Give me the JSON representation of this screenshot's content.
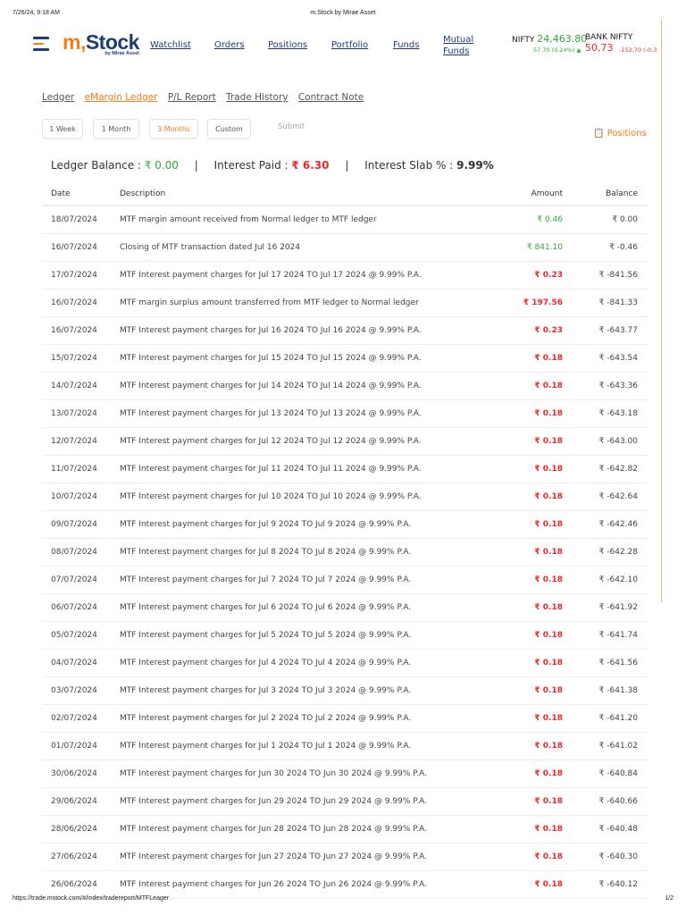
{
  "print_header": {
    "datetime": "7/26/24, 9:18 AM",
    "title": "m.Stock by Mirae Asset"
  },
  "logo": {
    "m": "m,",
    "stock": "Stock",
    "tagline": "by Mirae Asset"
  },
  "nav": [
    "Watchlist",
    "Orders",
    "Positions",
    "Portfolio",
    "Funds",
    "Mutual",
    "Funds"
  ],
  "indices": [
    {
      "name": "NIFTY",
      "value": "24,463.80",
      "change": "57.70 (0.24%)",
      "color": "#2eaa3c"
    },
    {
      "name": "BANK NIFTY",
      "value": "50,73",
      "change": "-152.70 (-0.3",
      "color": "#f0282d"
    }
  ],
  "subtabs": [
    "Ledger",
    "eMargin Ledger",
    "P/L Report",
    "Trade History",
    "Contract Note"
  ],
  "filters": [
    "1 Week",
    "1 Month",
    "3 Months",
    "Custom"
  ],
  "submit": "Submit",
  "positions_link": "Positions",
  "summary": {
    "ledger_label": "Ledger Balance : ",
    "ledger_value": "₹ 0.00",
    "interest_label": "Interest Paid : ",
    "interest_value": "₹ 6.30",
    "slab_label": "Interest Slab % : ",
    "slab_value": "9.99%",
    "sep": "|"
  },
  "table": {
    "headers": [
      "Date",
      "Description",
      "Amount",
      "Balance"
    ],
    "rows": [
      [
        "18/07/2024",
        "MTF margin amount received from Normal ledger to MTF ledger",
        "₹ 0.46",
        "₹ 0.00",
        "g"
      ],
      [
        "16/07/2024",
        "Closing of MTF transaction dated Jul 16 2024",
        "₹ 841.10",
        "₹ -0.46",
        "g"
      ],
      [
        "17/07/2024",
        "MTF Interest payment charges for Jul 17 2024 TO Jul 17 2024 @ 9.99% P.A.",
        "₹ 0.23",
        "₹ -841.56",
        "r"
      ],
      [
        "16/07/2024",
        "MTF margin surplus amount transferred from MTF ledger to Normal ledger",
        "₹ 197.56",
        "₹ -841.33",
        "r"
      ],
      [
        "16/07/2024",
        "MTF Interest payment charges for Jul 16 2024 TO Jul 16 2024 @ 9.99% P.A.",
        "₹ 0.23",
        "₹ -643.77",
        "r"
      ],
      [
        "15/07/2024",
        "MTF Interest payment charges for Jul 15 2024 TO Jul 15 2024 @ 9.99% P.A.",
        "₹ 0.18",
        "₹ -643.54",
        "r"
      ],
      [
        "14/07/2024",
        "MTF Interest payment charges for Jul 14 2024 TO Jul 14 2024 @ 9.99% P.A.",
        "₹ 0.18",
        "₹ -643.36",
        "r"
      ],
      [
        "13/07/2024",
        "MTF Interest payment charges for Jul 13 2024 TO Jul 13 2024 @ 9.99% P.A.",
        "₹ 0.18",
        "₹ -643.18",
        "r"
      ],
      [
        "12/07/2024",
        "MTF Interest payment charges for Jul 12 2024 TO Jul 12 2024 @ 9.99% P.A.",
        "₹ 0.18",
        "₹ -643.00",
        "r"
      ],
      [
        "11/07/2024",
        "MTF Interest payment charges for Jul 11 2024 TO Jul 11 2024 @ 9.99% P.A.",
        "₹ 0.18",
        "₹ -642.82",
        "r"
      ],
      [
        "10/07/2024",
        "MTF Interest payment charges for Jul 10 2024 TO Jul 10 2024 @ 9.99% P.A.",
        "₹ 0.18",
        "₹ -642.64",
        "r"
      ],
      [
        "09/07/2024",
        "MTF Interest payment charges for Jul 9 2024 TO Jul 9 2024 @ 9.99% P.A.",
        "₹ 0.18",
        "₹ -642.46",
        "r"
      ],
      [
        "08/07/2024",
        "MTF Interest payment charges for Jul 8 2024 TO Jul 8 2024 @ 9.99% P.A.",
        "₹ 0.18",
        "₹ -642.28",
        "r"
      ],
      [
        "07/07/2024",
        "MTF Interest payment charges for Jul 7 2024 TO Jul 7 2024 @ 9.99% P.A.",
        "₹ 0.18",
        "₹ -642.10",
        "r"
      ],
      [
        "06/07/2024",
        "MTF Interest payment charges for Jul 6 2024 TO Jul 6 2024 @ 9.99% P.A.",
        "₹ 0.18",
        "₹ -641.92",
        "r"
      ],
      [
        "05/07/2024",
        "MTF Interest payment charges for Jul 5 2024 TO Jul 5 2024 @ 9.99% P.A.",
        "₹ 0.18",
        "₹ -641.74",
        "r"
      ],
      [
        "04/07/2024",
        "MTF Interest payment charges for Jul 4 2024 TO Jul 4 2024 @ 9.99% P.A.",
        "₹ 0.18",
        "₹ -641.56",
        "r"
      ],
      [
        "03/07/2024",
        "MTF Interest payment charges for Jul 3 2024 TO Jul 3 2024 @ 9.99% P.A.",
        "₹ 0.18",
        "₹ -641.38",
        "r"
      ],
      [
        "02/07/2024",
        "MTF Interest payment charges for Jul 2 2024 TO Jul 2 2024 @ 9.99% P.A.",
        "₹ 0.18",
        "₹ -641.20",
        "r"
      ],
      [
        "01/07/2024",
        "MTF Interest payment charges for Jul 1 2024 TO Jul 1 2024 @ 9.99% P.A.",
        "₹ 0.18",
        "₹ -641.02",
        "r"
      ],
      [
        "30/06/2024",
        "MTF Interest payment charges for Jun 30 2024 TO Jun 30 2024 @ 9.99% P.A.",
        "₹ 0.18",
        "₹ -640.84",
        "r"
      ],
      [
        "29/06/2024",
        "MTF Interest payment charges for Jun 29 2024 TO Jun 29 2024 @ 9.99% P.A.",
        "₹ 0.18",
        "₹ -640.66",
        "r"
      ],
      [
        "28/06/2024",
        "MTF Interest payment charges for Jun 28 2024 TO Jun 28 2024 @ 9.99% P.A.",
        "₹ 0.18",
        "₹ -640.48",
        "r"
      ],
      [
        "27/06/2024",
        "MTF Interest payment charges for Jun 27 2024 TO Jun 27 2024 @ 9.99% P.A.",
        "₹ 0.18",
        "₹ -640.30",
        "r"
      ],
      [
        "26/06/2024",
        "MTF Interest payment charges for Jun 26 2024 TO Jun 26 2024 @ 9.99% P.A.",
        "₹ 0.18",
        "₹ -640.12",
        "r"
      ]
    ]
  },
  "footer": {
    "url": "https://trade.mstock.com/#/index/tradereport/MTFLeager",
    "page": "1/2"
  }
}
